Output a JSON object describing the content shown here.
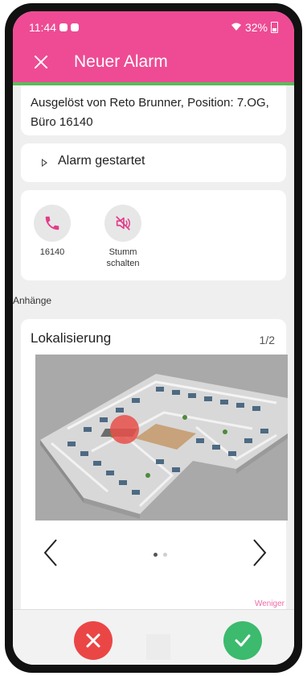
{
  "status_bar": {
    "time": "11:44",
    "battery": "32%"
  },
  "app_bar": {
    "title": "Neuer Alarm"
  },
  "trigger_info": "Ausgelöst von Reto Brunner, Position: 7.OG, Büro 16140",
  "alarm_status": {
    "label": "Alarm gestartet"
  },
  "actions": {
    "call_label": "16140",
    "mute_label": "Stumm schalten"
  },
  "attachments": {
    "section_label": "Anhänge",
    "card_title": "Lokalisierung",
    "page_indicator": "1/2",
    "current_page": 1,
    "page_count": 2
  },
  "less_link": "Weniger",
  "icons": {
    "close": "close-icon",
    "expand": "expand-triangle-icon",
    "call": "phone-icon",
    "mute": "mute-icon",
    "prev": "chevron-left-icon",
    "next": "chevron-right-icon",
    "reject": "close-icon",
    "accept": "check-icon"
  },
  "colors": {
    "brand": "#ee4b94",
    "success_line": "#5cba5b",
    "reject": "#eb4646",
    "accept": "#3cba6d"
  }
}
